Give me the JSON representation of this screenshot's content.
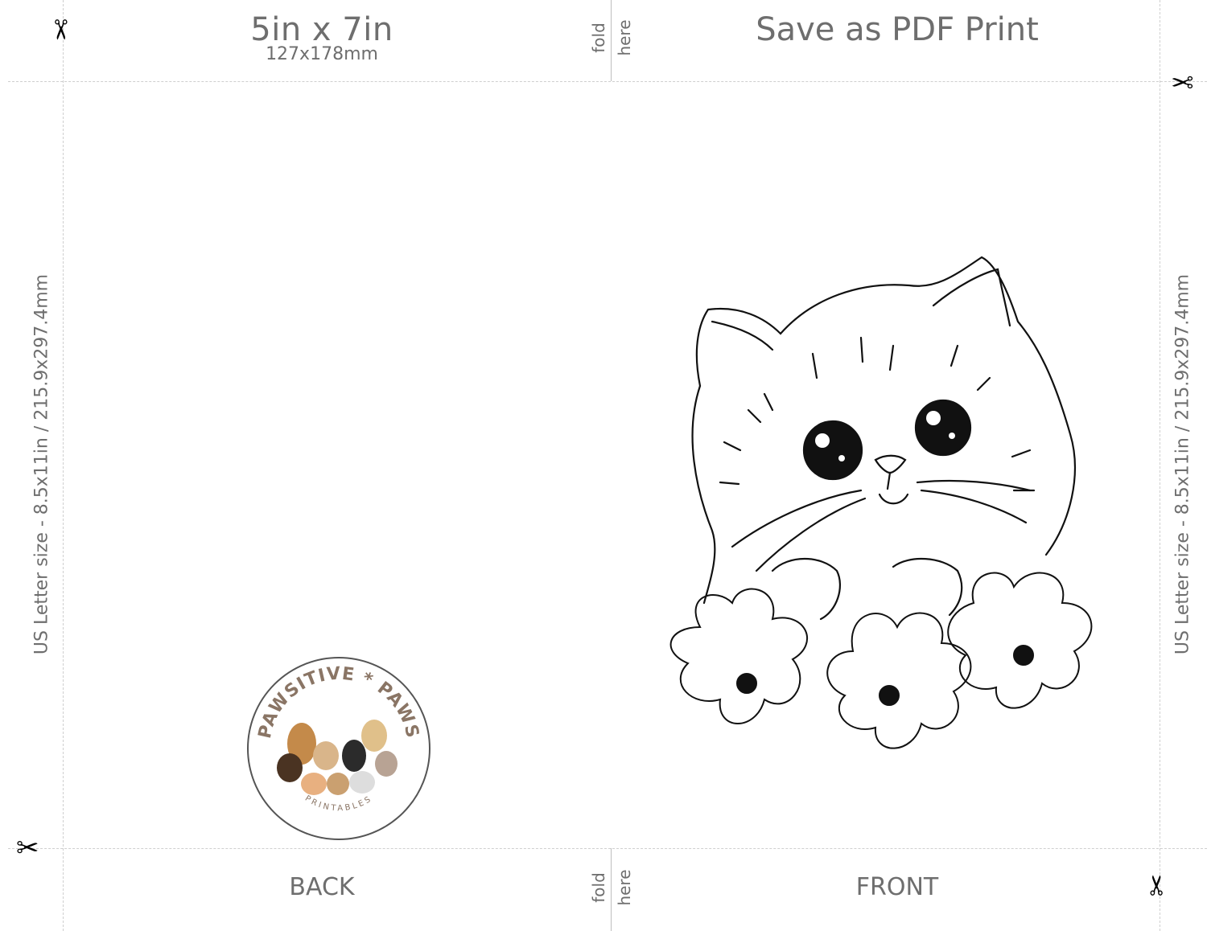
{
  "top": {
    "size_title": "5in x 7in",
    "size_sub": "127x178mm",
    "fold_word_1": "fold",
    "fold_word_2": "here",
    "save_title": "Save as PDF Print"
  },
  "side": {
    "left_label": "US Letter size - 8.5x11in / 215.9x297.4mm",
    "right_label": "US Letter size - 8.5x11in / 215.9x297.4mm"
  },
  "bottom": {
    "back_label": "BACK",
    "front_label": "FRONT",
    "fold_word_1": "fold",
    "fold_word_2": "here"
  },
  "logo": {
    "arc_text": "PAWSITIVE * PAWS",
    "sub_text": "PRINTABLES"
  },
  "icons": [
    "scissors-icon",
    "kitten-illustration",
    "brand-logo"
  ]
}
